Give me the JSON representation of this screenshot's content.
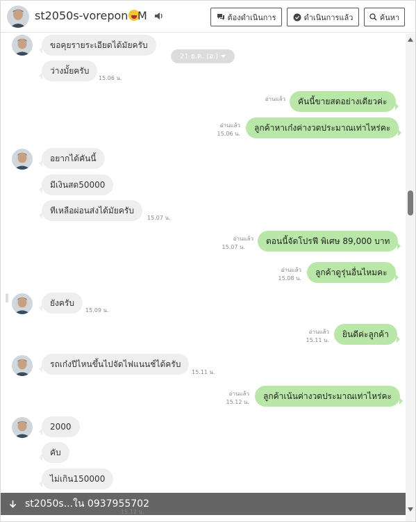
{
  "header": {
    "name": "st2050s-vorepon",
    "badge": "M",
    "buttons": {
      "pending": "ต้องดำเนินการ",
      "done": "ดำเนินการแล้ว",
      "search": "ค้นหา"
    }
  },
  "date_chip": "21 ธ.ค. (อ.)",
  "messages": [
    {
      "text": "ขอคุยรายระเอียดได้มัยครับ"
    },
    {
      "text": "ว่างมั้ยครับ",
      "time": "15.06 น."
    },
    {
      "text": "คันนี้ขายสดอย่างเดียวค่ะ",
      "read": "อ่านแล้ว"
    },
    {
      "text": "ลูกค้าหาเก๋งค่างวดประมาณเท่าไหร่คะ",
      "read": "อ่านแล้ว",
      "time": "15.06 น."
    },
    {
      "text": "อยากได้คันนี้"
    },
    {
      "text": "มีเงินสด50000"
    },
    {
      "text": "ทีเหลือผ่อนส่งได้มัยครับ",
      "time": "15.07 น."
    },
    {
      "text": "ตอนนี้จัดโปรฟี พิเศษ 89,000 บาท",
      "read": "อ่านแล้ว",
      "time": "15.07 น."
    },
    {
      "text": "ลูกค้าดูรุ่นอื่นไหมคะ",
      "read": "อ่านแล้ว",
      "time": "15.08 น."
    },
    {
      "text": "ยังครับ",
      "time": "15.09 น."
    },
    {
      "text": "ยินดีค่ะลูกค้า",
      "read": "อ่านแล้ว",
      "time": "15.11 น."
    },
    {
      "text": "รถเก๋งปีไหนขึ้นไปจัดไฟแนนช์ได้ครับ",
      "time": "15.11 น."
    },
    {
      "text": "ลูกค้าเน้นค่างวดประมาณเท่าไหร่คะ",
      "read": "อ่านแล้ว",
      "time": "15.12 น."
    },
    {
      "text": "2000"
    },
    {
      "text": "คับ"
    },
    {
      "text": "ไม่เกิน150000"
    }
  ],
  "bottom_bar": {
    "label": "st2050s...ใน 0937955702"
  },
  "partial_time": "15.12 น.",
  "colors": {
    "outgoing": "#b8e7a7",
    "incoming": "#eeeeee",
    "bar": "#505050"
  }
}
